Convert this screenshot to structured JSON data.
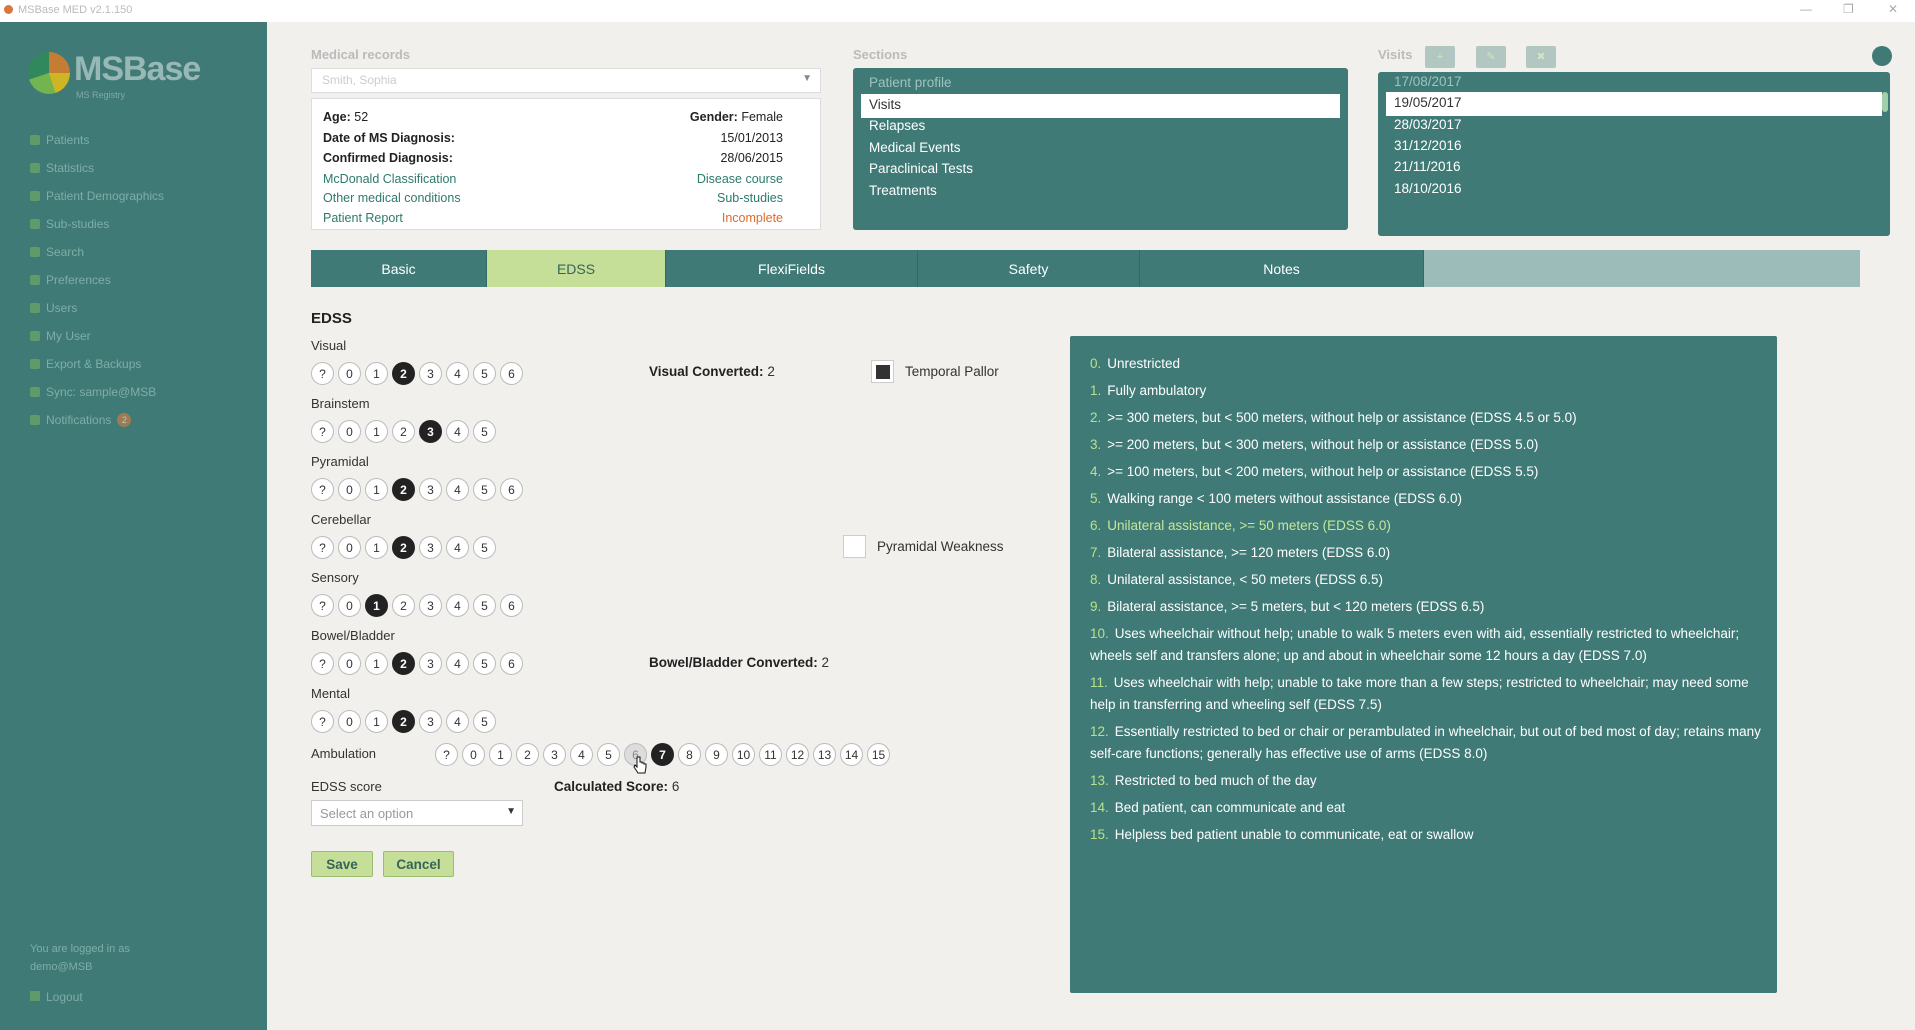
{
  "window": {
    "title": "MSBase MED v2.1.150",
    "minimize": "—",
    "maximize": "❐",
    "close": "✕"
  },
  "sidebar": {
    "logo_name": "MSBase",
    "logo_tag": "MS Registry",
    "nav": [
      {
        "label": "Patients"
      },
      {
        "label": "Statistics"
      },
      {
        "label": "Patient Demographics"
      },
      {
        "label": "Sub-studies"
      },
      {
        "label": "Search"
      },
      {
        "label": "Preferences"
      },
      {
        "label": "Users"
      },
      {
        "label": "My User"
      },
      {
        "label": "Export & Backups"
      },
      {
        "label": "Sync: sample@MSB"
      },
      {
        "label": "Notifications",
        "badge": "2"
      }
    ],
    "logged_in_line1": "You are logged in as",
    "logged_in_line2": "demo@MSB",
    "logout": "Logout"
  },
  "labels": {
    "medical_records": "Medical records",
    "sections": "Sections",
    "visits": "Visits"
  },
  "patient_select_value": "Smith, Sophia",
  "patient": {
    "age_label": "Age:",
    "age": "52",
    "gender_label": "Gender:",
    "gender": "Female",
    "dx_label": "Date of MS Diagnosis:",
    "dx_date": "15/01/2013",
    "confirmed_label": "Confirmed Diagnosis:",
    "confirmed_date": "28/06/2015",
    "mcdonald": "McDonald Classification",
    "disease_course": "Disease course",
    "other_conditions": "Other medical conditions",
    "sub_studies": "Sub-studies",
    "patient_report": "Patient Report",
    "report_status": "Incomplete"
  },
  "sections": [
    "Patient profile",
    "Visits",
    "Relapses",
    "Medical Events",
    "Paraclinical Tests",
    "Treatments"
  ],
  "visits": [
    "17/08/2017",
    "19/05/2017",
    "28/03/2017",
    "31/12/2016",
    "21/11/2016",
    "18/10/2016"
  ],
  "visit_buttons": [
    "+",
    "✎",
    "✖"
  ],
  "tabs": [
    "Basic",
    "EDSS",
    "FlexiFields",
    "Safety",
    "Notes"
  ],
  "active_tab": "EDSS",
  "edss": {
    "title": "EDSS",
    "groups": [
      {
        "label": "Visual",
        "options": [
          "?",
          "0",
          "1",
          "2",
          "3",
          "4",
          "5",
          "6"
        ],
        "selected": "2"
      },
      {
        "label": "Brainstem",
        "options": [
          "?",
          "0",
          "1",
          "2",
          "3",
          "4",
          "5"
        ],
        "selected": "3"
      },
      {
        "label": "Pyramidal",
        "options": [
          "?",
          "0",
          "1",
          "2",
          "3",
          "4",
          "5",
          "6"
        ],
        "selected": "2"
      },
      {
        "label": "Cerebellar",
        "options": [
          "?",
          "0",
          "1",
          "2",
          "3",
          "4",
          "5"
        ],
        "selected": "2"
      },
      {
        "label": "Sensory",
        "options": [
          "?",
          "0",
          "1",
          "2",
          "3",
          "4",
          "5",
          "6"
        ],
        "selected": "1"
      },
      {
        "label": "Bowel/Bladder",
        "options": [
          "?",
          "0",
          "1",
          "2",
          "3",
          "4",
          "5",
          "6"
        ],
        "selected": "2"
      },
      {
        "label": "Mental",
        "options": [
          "?",
          "0",
          "1",
          "2",
          "3",
          "4",
          "5"
        ],
        "selected": "2"
      }
    ],
    "ambulation": {
      "label": "Ambulation",
      "options": [
        "?",
        "0",
        "1",
        "2",
        "3",
        "4",
        "5",
        "6",
        "7",
        "8",
        "9",
        "10",
        "11",
        "12",
        "13",
        "14",
        "15"
      ],
      "selected": "7",
      "hover": "6"
    },
    "visual_converted_label": "Visual Converted:",
    "visual_converted": "2",
    "bowel_converted_label": "Bowel/Bladder Converted:",
    "bowel_converted": "2",
    "temporal_pallor": "Temporal Pallor",
    "pyramidal_weakness": "Pyramidal Weakness",
    "score_label": "EDSS score",
    "score_placeholder": "Select an option",
    "calculated_label": "Calculated Score:",
    "calculated": "6",
    "save": "Save",
    "cancel": "Cancel"
  },
  "ambulation_descriptions": [
    {
      "num": "0.",
      "text": "Unrestricted"
    },
    {
      "num": "1.",
      "text": "Fully ambulatory"
    },
    {
      "num": "2.",
      "text": ">= 300 meters, but < 500 meters, without help or assistance (EDSS 4.5 or 5.0)"
    },
    {
      "num": "3.",
      "text": ">= 200 meters, but < 300 meters, without help or assistance (EDSS 5.0)"
    },
    {
      "num": "4.",
      "text": ">= 100 meters, but < 200 meters, without help or assistance (EDSS 5.5)"
    },
    {
      "num": "5.",
      "text": "Walking range < 100 meters without assistance (EDSS 6.0)"
    },
    {
      "num": "6.",
      "text": "Unilateral assistance, >= 50 meters (EDSS 6.0)",
      "highlight": true
    },
    {
      "num": "7.",
      "text": "Bilateral assistance, >= 120 meters (EDSS 6.0)"
    },
    {
      "num": "8.",
      "text": "Unilateral assistance, < 50 meters (EDSS 6.5)"
    },
    {
      "num": "9.",
      "text": "Bilateral assistance, >= 5 meters, but < 120 meters (EDSS 6.5)"
    },
    {
      "num": "10.",
      "text": "Uses wheelchair without help; unable to walk 5 meters even with aid, essentially restricted to wheelchair; wheels self and transfers alone; up and about in wheelchair some 12 hours a day (EDSS 7.0)"
    },
    {
      "num": "11.",
      "text": "Uses wheelchair with help; unable to take more than a few steps; restricted to wheelchair; may need some help in transferring and wheeling self (EDSS 7.5)"
    },
    {
      "num": "12.",
      "text": "Essentially restricted to bed or chair or perambulated in wheelchair, but out of bed most of day; retains many self-care functions; generally has effective use of arms (EDSS 8.0)"
    },
    {
      "num": "13.",
      "text": "Restricted to bed much of the day"
    },
    {
      "num": "14.",
      "text": "Bed patient, can communicate and eat"
    },
    {
      "num": "15.",
      "text": "Helpless bed patient unable to communicate, eat or swallow"
    }
  ],
  "colors": {
    "teal": "#3f7a76",
    "accent": "#c5de98",
    "link": "#2d7a6b",
    "warning": "#e06a2b"
  }
}
